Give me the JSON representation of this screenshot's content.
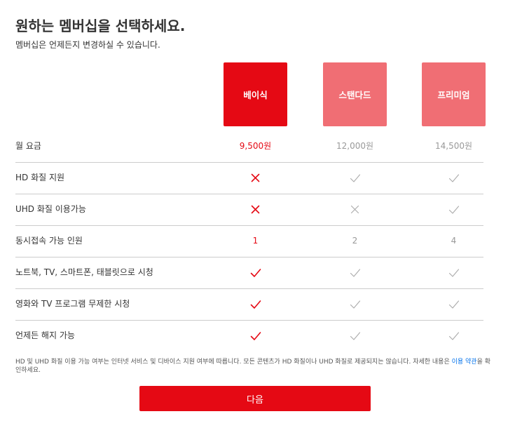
{
  "header": {
    "title": "원하는 멤버십을 선택하세요.",
    "subtitle": "멤버십은 언제든지 변경하실 수 있습니다."
  },
  "plans": [
    {
      "name": "베이식",
      "selected": true
    },
    {
      "name": "스탠다드",
      "selected": false
    },
    {
      "name": "프리미엄",
      "selected": false
    }
  ],
  "colors": {
    "accent": "#e50914",
    "plan_unselected": "#f06e74",
    "muted": "#999999",
    "divider": "#cccccc",
    "link": "#0071eb"
  },
  "rows": [
    {
      "label": "월 요금",
      "type": "text",
      "values": [
        "9,500원",
        "12,000원",
        "14,500원"
      ]
    },
    {
      "label": "HD 화질 지원",
      "type": "icon",
      "values": [
        "x-icon",
        "check-icon",
        "check-icon"
      ]
    },
    {
      "label": "UHD 화질 이용가능",
      "type": "icon",
      "values": [
        "x-icon",
        "x-icon",
        "check-icon"
      ]
    },
    {
      "label": "동시접속 가능 인원",
      "type": "text",
      "values": [
        "1",
        "2",
        "4"
      ]
    },
    {
      "label": "노트북, TV, 스마트폰, 태블릿으로 시청",
      "type": "icon",
      "values": [
        "check-icon",
        "check-icon",
        "check-icon"
      ]
    },
    {
      "label": "영화와 TV 프로그램 무제한 시청",
      "type": "icon",
      "values": [
        "check-icon",
        "check-icon",
        "check-icon"
      ]
    },
    {
      "label": "언제든 해지 가능",
      "type": "icon",
      "values": [
        "check-icon",
        "check-icon",
        "check-icon"
      ]
    }
  ],
  "footnote": {
    "text_before": "HD 및 UHD 화질 이용 가능 여부는 인터넷 서비스 및 디바이스 지원 여부에 따릅니다. 모든 콘텐츠가 HD 화질이나 UHD 화질로 제공되지는 않습니다. 자세한 내용은 ",
    "link_text": "이용 약관",
    "text_after": "을 확인하세요."
  },
  "next_button": {
    "label": "다음"
  }
}
